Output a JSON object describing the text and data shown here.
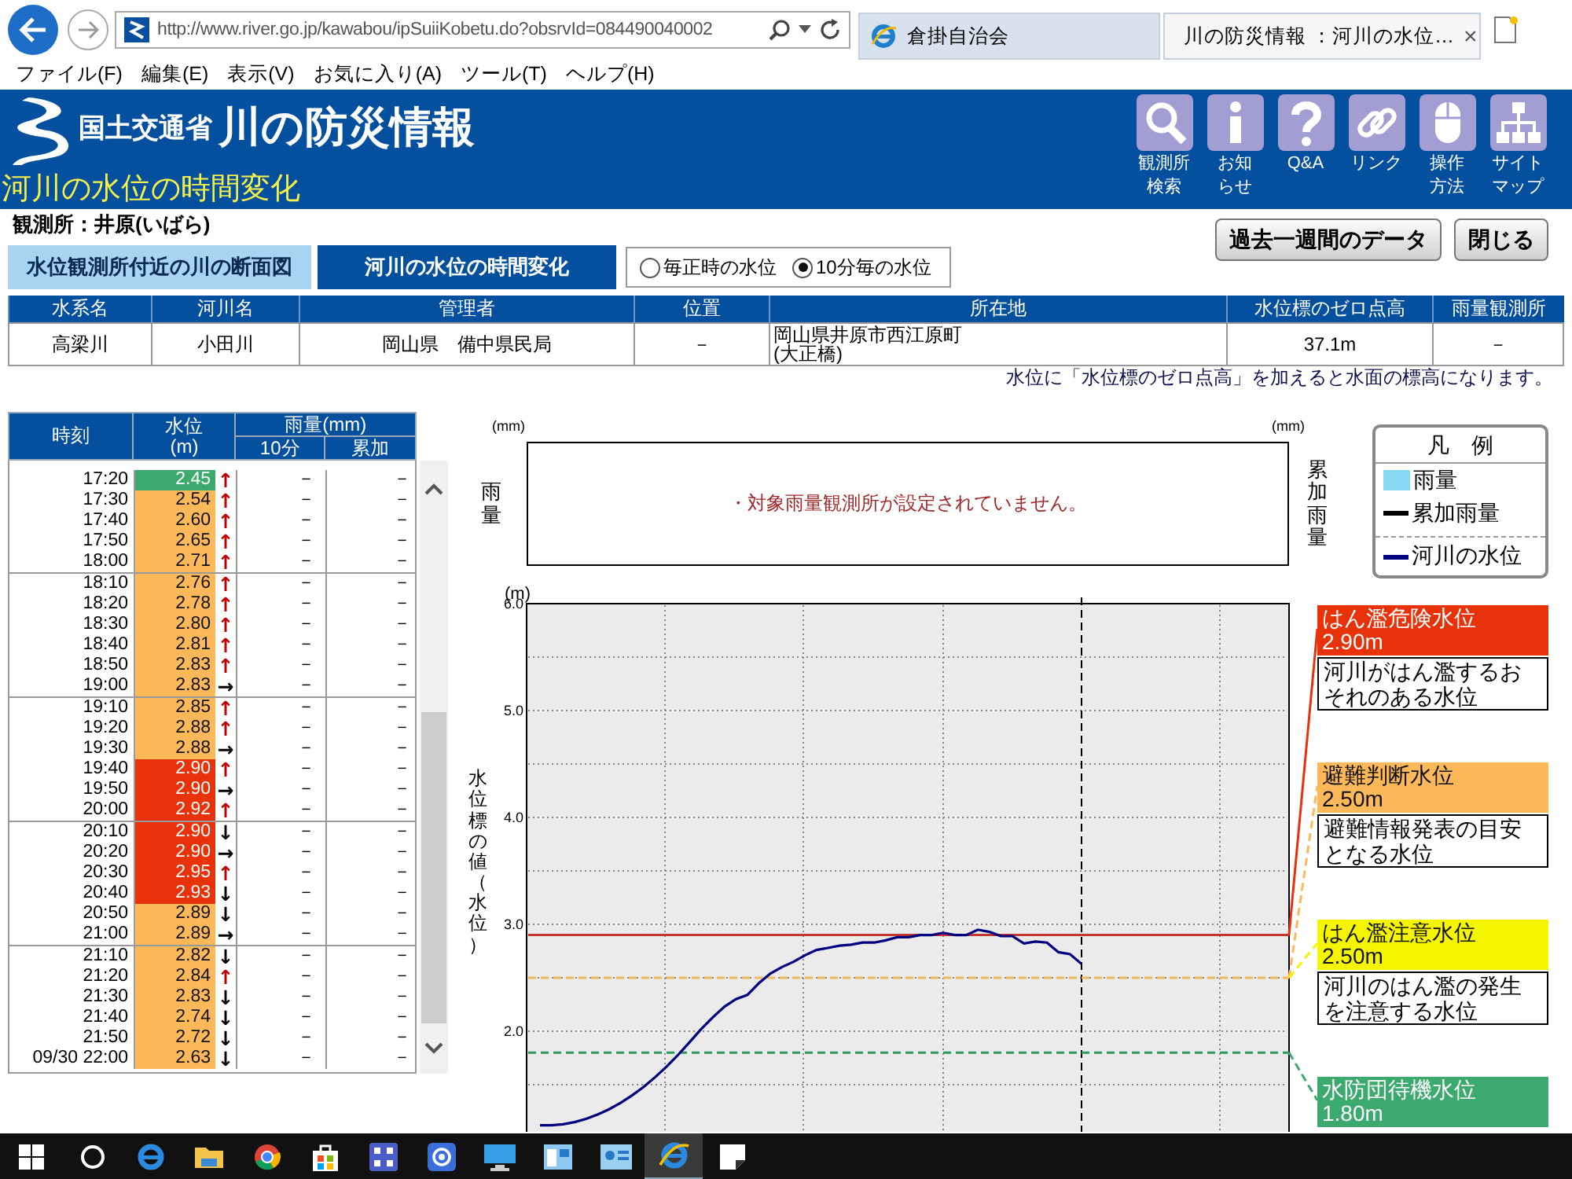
{
  "browser": {
    "address": "http://www.river.go.jp/kawabou/ipSuiiKobetu.do?obsrvId=084490040002",
    "tabs": [
      {
        "title": "倉掛自治会",
        "kind": "ie",
        "selected": false
      },
      {
        "title": "川の防災情報 ：河川の水位…",
        "kind": "site",
        "selected": true,
        "close": "×"
      }
    ]
  },
  "menu": [
    "ファイル(F)",
    "編集(E)",
    "表示(V)",
    "お気に入り(A)",
    "ツール(T)",
    "ヘルプ(H)"
  ],
  "header": {
    "ministry": "国土交通省",
    "site_title": "川の防災情報",
    "page_title": "河川の水位の時間変化",
    "nav": [
      {
        "kind": "search",
        "label_lines": [
          "観測所",
          "検索"
        ]
      },
      {
        "kind": "info",
        "label_lines": [
          "お知",
          "らせ"
        ]
      },
      {
        "kind": "help",
        "label_lines": [
          "Q&A"
        ]
      },
      {
        "kind": "link",
        "label_lines": [
          "リンク"
        ]
      },
      {
        "kind": "mouse",
        "label_lines": [
          "操作",
          "方法"
        ]
      },
      {
        "kind": "sitemap",
        "label_lines": [
          "サイト",
          "マップ"
        ]
      }
    ]
  },
  "station": "観測所：井原(いばら)",
  "buttons": [
    "過去一週間のデータ",
    "閉じる"
  ],
  "view_tabs": [
    {
      "label": "水位観測所付近の川の断面図",
      "selected": false
    },
    {
      "label": "河川の水位の時間変化",
      "selected": true
    }
  ],
  "interval_options": [
    {
      "label": "毎正時の水位",
      "selected": false
    },
    {
      "label": "10分毎の水位",
      "selected": true
    }
  ],
  "info_table": {
    "columns": [
      "水系名",
      "河川名",
      "管理者",
      "位置",
      "所在地",
      "水位標のゼロ点高",
      "雨量観測所"
    ],
    "rows": [
      [
        "高梁川",
        "小田川",
        "岡山県　備中県民局",
        "－",
        "岡山県井原市西江原町\n(大正橋)",
        "37.1m",
        "－"
      ]
    ]
  },
  "note": "水位に「水位標のゼロ点高」を加えると水面の標高になります。",
  "level_table": {
    "columns": {
      "time": "時刻",
      "water": "水位\n(m)",
      "rain": "雨量(mm)",
      "rain_10min": "10分",
      "rain_total": "累加"
    },
    "groups": [
      {
        "rows": [
          {
            "time": "17:20",
            "water_level": "2.45",
            "color": "#3caa6e",
            "arrow": {
              "text": "↑",
              "color": "#c00000"
            },
            "rain_10min": "－",
            "rain_total": "－"
          },
          {
            "time": "17:30",
            "water_level": "2.54",
            "color": "#fdb85a",
            "arrow": {
              "text": "↑",
              "color": "#c00000"
            },
            "rain_10min": "－",
            "rain_total": "－"
          },
          {
            "time": "17:40",
            "water_level": "2.60",
            "color": "#fdb85a",
            "arrow": {
              "text": "↑",
              "color": "#c00000"
            },
            "rain_10min": "－",
            "rain_total": "－"
          },
          {
            "time": "17:50",
            "water_level": "2.65",
            "color": "#fdb85a",
            "arrow": {
              "text": "↑",
              "color": "#c00000"
            },
            "rain_10min": "－",
            "rain_total": "－"
          },
          {
            "time": "18:00",
            "water_level": "2.71",
            "color": "#fdb85a",
            "arrow": {
              "text": "↑",
              "color": "#c00000"
            },
            "rain_10min": "－",
            "rain_total": "－"
          }
        ]
      },
      {
        "rows": [
          {
            "time": "18:10",
            "water_level": "2.76",
            "color": "#fdb85a",
            "arrow": {
              "text": "↑",
              "color": "#c00000"
            },
            "rain_10min": "－",
            "rain_total": "－"
          },
          {
            "time": "18:20",
            "water_level": "2.78",
            "color": "#fdb85a",
            "arrow": {
              "text": "↑",
              "color": "#c00000"
            },
            "rain_10min": "－",
            "rain_total": "－"
          },
          {
            "time": "18:30",
            "water_level": "2.80",
            "color": "#fdb85a",
            "arrow": {
              "text": "↑",
              "color": "#c00000"
            },
            "rain_10min": "－",
            "rain_total": "－"
          },
          {
            "time": "18:40",
            "water_level": "2.81",
            "color": "#fdb85a",
            "arrow": {
              "text": "↑",
              "color": "#c00000"
            },
            "rain_10min": "－",
            "rain_total": "－"
          },
          {
            "time": "18:50",
            "water_level": "2.83",
            "color": "#fdb85a",
            "arrow": {
              "text": "↑",
              "color": "#c00000"
            },
            "rain_10min": "－",
            "rain_total": "－"
          },
          {
            "time": "19:00",
            "water_level": "2.83",
            "color": "#fdb85a",
            "arrow": {
              "text": "→",
              "color": "#000000"
            },
            "rain_10min": "－",
            "rain_total": "－"
          }
        ]
      },
      {
        "rows": [
          {
            "time": "19:10",
            "water_level": "2.85",
            "color": "#fdb85a",
            "arrow": {
              "text": "↑",
              "color": "#c00000"
            },
            "rain_10min": "－",
            "rain_total": "－"
          },
          {
            "time": "19:20",
            "water_level": "2.88",
            "color": "#fdb85a",
            "arrow": {
              "text": "↑",
              "color": "#c00000"
            },
            "rain_10min": "－",
            "rain_total": "－"
          },
          {
            "time": "19:30",
            "water_level": "2.88",
            "color": "#fdb85a",
            "arrow": {
              "text": "→",
              "color": "#000000"
            },
            "rain_10min": "－",
            "rain_total": "－"
          },
          {
            "time": "19:40",
            "water_level": "2.90",
            "color": "#e8320a",
            "arrow": {
              "text": "↑",
              "color": "#c00000"
            },
            "rain_10min": "－",
            "rain_total": "－"
          },
          {
            "time": "19:50",
            "water_level": "2.90",
            "color": "#e8320a",
            "arrow": {
              "text": "→",
              "color": "#000000"
            },
            "rain_10min": "－",
            "rain_total": "－"
          },
          {
            "time": "20:00",
            "water_level": "2.92",
            "color": "#e8320a",
            "arrow": {
              "text": "↑",
              "color": "#c00000"
            },
            "rain_10min": "－",
            "rain_total": "－"
          }
        ]
      },
      {
        "rows": [
          {
            "time": "20:10",
            "water_level": "2.90",
            "color": "#e8320a",
            "arrow": {
              "text": "↓",
              "color": "#000000"
            },
            "rain_10min": "－",
            "rain_total": "－"
          },
          {
            "time": "20:20",
            "water_level": "2.90",
            "color": "#e8320a",
            "arrow": {
              "text": "→",
              "color": "#000000"
            },
            "rain_10min": "－",
            "rain_total": "－"
          },
          {
            "time": "20:30",
            "water_level": "2.95",
            "color": "#e8320a",
            "arrow": {
              "text": "↑",
              "color": "#c00000"
            },
            "rain_10min": "－",
            "rain_total": "－"
          },
          {
            "time": "20:40",
            "water_level": "2.93",
            "color": "#e8320a",
            "arrow": {
              "text": "↓",
              "color": "#000000"
            },
            "rain_10min": "－",
            "rain_total": "－"
          },
          {
            "time": "20:50",
            "water_level": "2.89",
            "color": "#fdb85a",
            "arrow": {
              "text": "↓",
              "color": "#000000"
            },
            "rain_10min": "－",
            "rain_total": "－"
          },
          {
            "time": "21:00",
            "water_level": "2.89",
            "color": "#fdb85a",
            "arrow": {
              "text": "→",
              "color": "#000000"
            },
            "rain_10min": "－",
            "rain_total": "－"
          }
        ]
      },
      {
        "rows": [
          {
            "time": "21:10",
            "water_level": "2.82",
            "color": "#fdb85a",
            "arrow": {
              "text": "↓",
              "color": "#000000"
            },
            "rain_10min": "－",
            "rain_total": "－"
          },
          {
            "time": "21:20",
            "water_level": "2.84",
            "color": "#fdb85a",
            "arrow": {
              "text": "↑",
              "color": "#c00000"
            },
            "rain_10min": "－",
            "rain_total": "－"
          },
          {
            "time": "21:30",
            "water_level": "2.83",
            "color": "#fdb85a",
            "arrow": {
              "text": "↓",
              "color": "#000000"
            },
            "rain_10min": "－",
            "rain_total": "－"
          },
          {
            "time": "21:40",
            "water_level": "2.74",
            "color": "#fdb85a",
            "arrow": {
              "text": "↓",
              "color": "#000000"
            },
            "rain_10min": "－",
            "rain_total": "－"
          },
          {
            "time": "21:50",
            "water_level": "2.72",
            "color": "#fdb85a",
            "arrow": {
              "text": "↓",
              "color": "#000000"
            },
            "rain_10min": "－",
            "rain_total": "－"
          },
          {
            "time": "09/30 22:00",
            "water_level": "2.63",
            "color": "#fdb85a",
            "arrow": {
              "text": "↓",
              "color": "#000000"
            },
            "rain_10min": "－",
            "rain_total": "－"
          }
        ]
      }
    ]
  },
  "rain_chart": {
    "left_unit": "(mm)",
    "right_unit": "(mm)",
    "left_label": "雨量",
    "right_label": "累加雨量",
    "message": "・対象雨量観測所が設定されていません。"
  },
  "legend": {
    "title": "凡　例",
    "items": [
      {
        "label": "雨量",
        "kind": "swatch",
        "color": "#87d8f5",
        "separated": false
      },
      {
        "label": "累加雨量",
        "kind": "line",
        "color": "#000000",
        "separated": false
      },
      {
        "label": "河川の水位",
        "kind": "line",
        "color": "#000080",
        "separated": true
      }
    ]
  },
  "water_chart": {
    "unit": "(m)",
    "chart_data": {
      "type": "line",
      "ylabel": "水位標の値（水位）",
      "ylim": [
        1,
        6
      ],
      "yticks": [
        {
          "value": 2,
          "label": "2.0"
        },
        {
          "value": 3,
          "label": "3.0"
        },
        {
          "value": 4,
          "label": "4.0"
        },
        {
          "value": 5,
          "label": "5.0"
        },
        {
          "value": 6,
          "label": "6.0"
        }
      ],
      "series": [
        {
          "color": "#000080",
          "values": [
            1.12,
            1.12,
            1.13,
            1.15,
            1.18,
            1.22,
            1.27,
            1.33,
            1.4,
            1.48,
            1.57,
            1.67,
            1.78,
            1.9,
            2.02,
            2.13,
            2.23,
            2.3,
            2.34,
            2.45,
            2.54,
            2.6,
            2.65,
            2.71,
            2.76,
            2.78,
            2.8,
            2.81,
            2.83,
            2.83,
            2.85,
            2.88,
            2.88,
            2.9,
            2.9,
            2.92,
            2.9,
            2.9,
            2.95,
            2.93,
            2.89,
            2.89,
            2.82,
            2.84,
            2.83,
            2.74,
            2.72,
            2.63
          ]
        }
      ],
      "grid": true,
      "ref_lines": [
        {
          "axis": "y",
          "value": 2.9,
          "color": "#c0392b"
        },
        {
          "axis": "y",
          "value": 2.5,
          "color": "#f5b860"
        },
        {
          "axis": "y",
          "value": 1.8,
          "color": "#2e9a5e"
        }
      ]
    }
  },
  "thresholds": [
    {
      "name": "はん濫危険水位",
      "value": "2.90m",
      "color": "#e8320a",
      "description": "河川がはん濫するおそれのある水位"
    },
    {
      "name": "避難判断水位",
      "value": "2.50m",
      "color": "#fdb85a",
      "description": "避難情報発表の目安となる水位"
    },
    {
      "name": "はん濫注意水位",
      "value": "2.50m",
      "color": "#f5f500",
      "description": "河川のはん濫の発生を注意する水位"
    },
    {
      "name": "水防団待機水位",
      "value": "1.80m",
      "color": "#3caa6e"
    }
  ],
  "taskbar": [
    {
      "kind": "start",
      "selected": false
    },
    {
      "kind": "search",
      "selected": false
    },
    {
      "kind": "edge",
      "selected": false
    },
    {
      "kind": "folder",
      "selected": false
    },
    {
      "kind": "chrome",
      "selected": false
    },
    {
      "kind": "store",
      "selected": false
    },
    {
      "kind": "grid",
      "selected": false
    },
    {
      "kind": "mail",
      "selected": false
    },
    {
      "kind": "monitor",
      "selected": false
    },
    {
      "kind": "window",
      "selected": false
    },
    {
      "kind": "card",
      "selected": false
    },
    {
      "kind": "ie",
      "selected": true
    },
    {
      "kind": "note",
      "selected": false
    }
  ]
}
